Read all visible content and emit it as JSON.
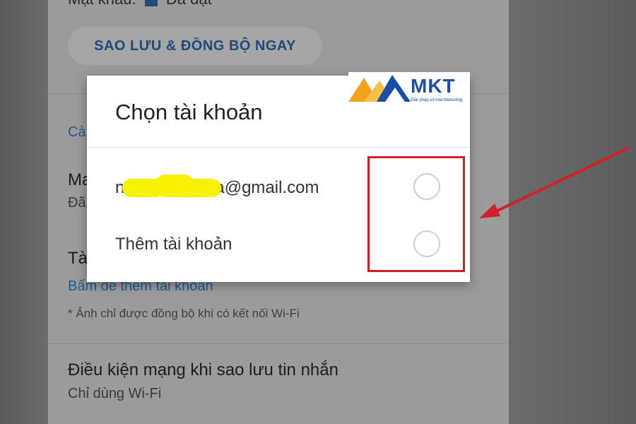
{
  "background_screen": {
    "top_cut_text": "Mật khẩu:",
    "top_cut_value": "Đã đặt",
    "sync_button_label": "SAO LƯU & ĐỒNG BỘ NGAY",
    "section_link": "Cà",
    "row1_title": "Ma",
    "row1_sub": "Đã",
    "row2_title": "Tà",
    "row2_link": "Bấm để thêm tài khoản",
    "wifi_note": "* Ảnh chỉ được đồng bộ khi có kết nối Wi-Fi",
    "row3_title": "Điều kiện mạng khi sao lưu tin nhắn",
    "row3_sub": "Chỉ dùng Wi-Fi"
  },
  "dialog": {
    "title": "Chọn tài khoản",
    "options": [
      {
        "label_prefix": "n",
        "label_suffix": "a@gmail.com",
        "redacted": true
      },
      {
        "label": "Thêm tài khoản"
      }
    ]
  },
  "logo": {
    "text": "MKT",
    "tagline": "Giải pháp số hóa Marketing"
  },
  "colors": {
    "highlight": "#d0202a",
    "link_blue": "#1f5a92",
    "logo_blue": "#1a4ea8",
    "logo_orange": "#f4a21e",
    "redaction": "#f6f200"
  },
  "icons": [
    "radio-unchecked-icon",
    "red-arrow-icon",
    "mkt-logo-mark-icon"
  ]
}
